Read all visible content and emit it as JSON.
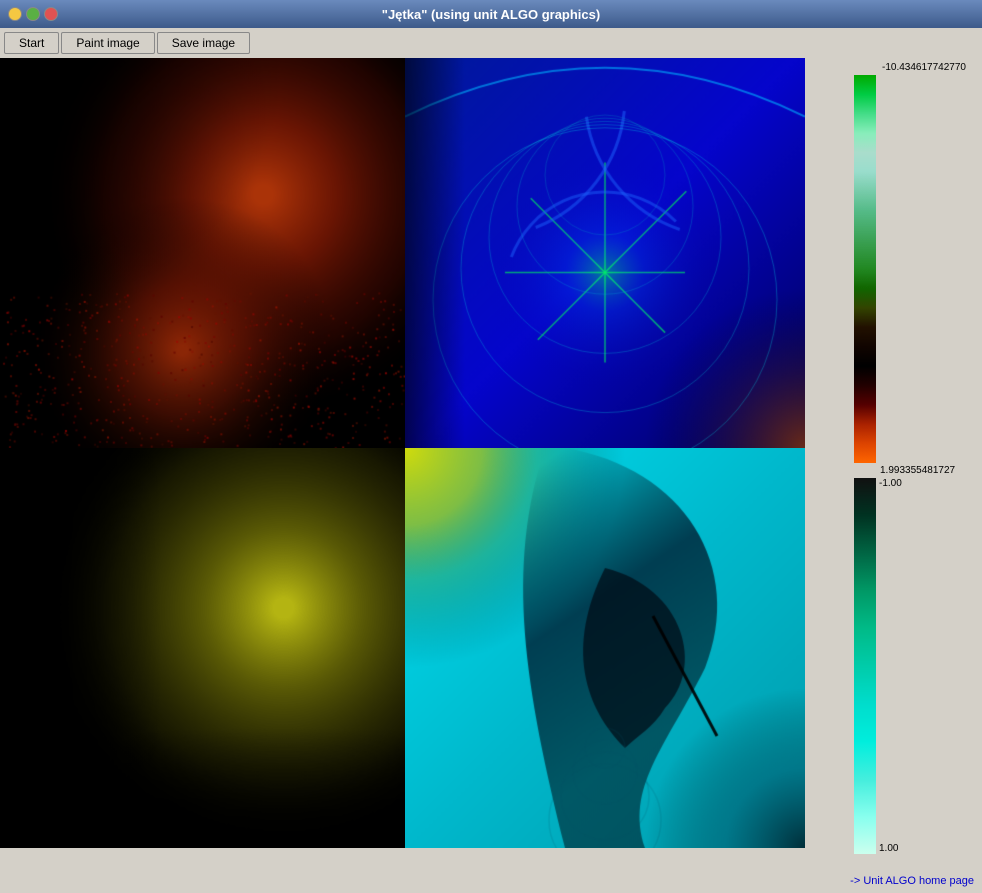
{
  "window": {
    "title": "\"Jętka\" (using unit ALGO graphics)"
  },
  "toolbar": {
    "buttons": [
      "Start",
      "Paint image",
      "Save image"
    ]
  },
  "colorbar": {
    "top_label": "-10.434617742770",
    "mid_label": "1.993355481727",
    "bottom_section_label1": "-1.00",
    "bottom_section_label2": "1.00"
  },
  "footer": {
    "link_text": "-> Unit ALGO home page"
  },
  "titlebar_buttons": {
    "minimize": "_",
    "maximize": "□",
    "close": "✕"
  }
}
